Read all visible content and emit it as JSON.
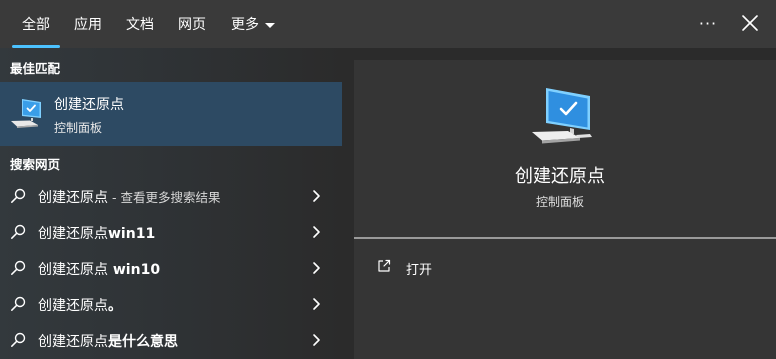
{
  "tabs": [
    {
      "label": "全部",
      "active": true
    },
    {
      "label": "应用",
      "active": false
    },
    {
      "label": "文档",
      "active": false
    },
    {
      "label": "网页",
      "active": false
    },
    {
      "label": "更多",
      "active": false
    }
  ],
  "more_options": "···",
  "best_match": {
    "section_title": "最佳匹配",
    "name": "创建还原点",
    "subtitle": "控制面板",
    "icon": "computer-checkmark-icon"
  },
  "web_search": {
    "section_title": "搜索网页",
    "items": [
      {
        "query": "创建还原点",
        "suffix": " - 查看更多搜索结果",
        "bold": ""
      },
      {
        "query": "创建还原点",
        "suffix": "",
        "bold": "win11"
      },
      {
        "query": "创建还原点",
        "suffix": "",
        "bold": " win10"
      },
      {
        "query": "创建还原点",
        "suffix": "",
        "bold": "。"
      },
      {
        "query": "创建还原点",
        "suffix": "",
        "bold": "是什么意思"
      }
    ]
  },
  "preview": {
    "title": "创建还原点",
    "subtitle": "控制面板",
    "actions": [
      {
        "label": "打开",
        "icon": "open-external-icon"
      }
    ]
  },
  "colors": {
    "accent": "#4cc2ff",
    "selected_bg": "#2d4a63",
    "panel_bg": "#353535"
  }
}
